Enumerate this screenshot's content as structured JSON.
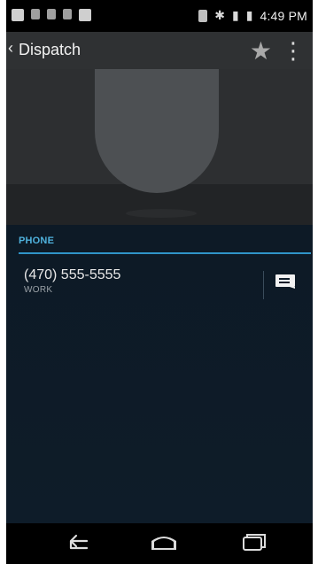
{
  "status_bar": {
    "time": "4:49 PM",
    "left_icons": [
      "grid-icon",
      "media-icon",
      "tablet-icon",
      "clipboard-icon",
      "square-icon"
    ],
    "right_icons": [
      "battery-outline-icon",
      "bluetooth-icon",
      "signal-icon",
      "battery-icon"
    ]
  },
  "action_bar": {
    "title": "Dispatch",
    "back_icon": "chevron-left-icon",
    "star_icon": "star-icon",
    "more_icon": "overflow-menu-icon"
  },
  "contact": {
    "section_title": "PHONE",
    "phone_number": "(470) 555-5555",
    "phone_type": "WORK",
    "message_icon": "message-icon"
  },
  "nav_bar": {
    "back_icon": "back-arrow-icon",
    "home_icon": "home-icon",
    "recents_icon": "recents-icon"
  },
  "colors": {
    "accent": "#4fb2dd",
    "divider": "#2f95c9",
    "background_dark": "#0d1a26"
  }
}
